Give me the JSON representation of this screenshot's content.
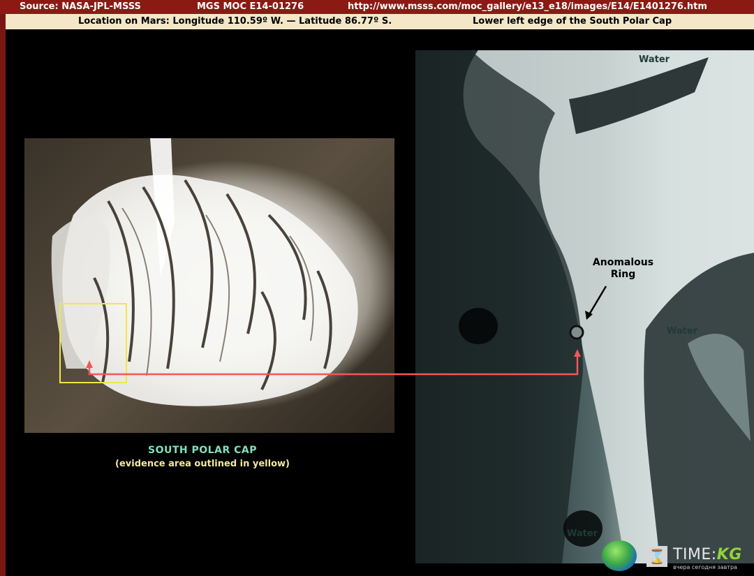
{
  "header": {
    "source": "Source:  NASA-JPL-MSSS",
    "image_id": "MGS MOC E14-01276",
    "url": "http://www.msss.com/moc_gallery/e13_e18/images/E14/E1401276.htm"
  },
  "subheader": {
    "location": "Location on Mars:  Longitude 110.59º W. — Latitude 86.77º S.",
    "description": "Lower left edge of the South Polar Cap"
  },
  "left_panel": {
    "caption_title": "SOUTH POLAR CAP",
    "caption_subtitle": "(evidence area outlined in yellow)"
  },
  "right_panel": {
    "anomaly_label": "Anomalous Ring",
    "water_labels": [
      "Water",
      "Water",
      "Water"
    ]
  },
  "logo": {
    "text_main": "TIME:",
    "text_accent": "KG",
    "tagline": "вчера сегодня завтра",
    "icon": "hourglass-icon"
  },
  "colors": {
    "top_bar": "#8b1a14",
    "sub_bar": "#f3e7c8",
    "caption_title": "#7fe0c0",
    "caption_sub": "#f3e7a0",
    "evidence_box": "#f2e64a",
    "connector_arrow": "#f05858"
  }
}
